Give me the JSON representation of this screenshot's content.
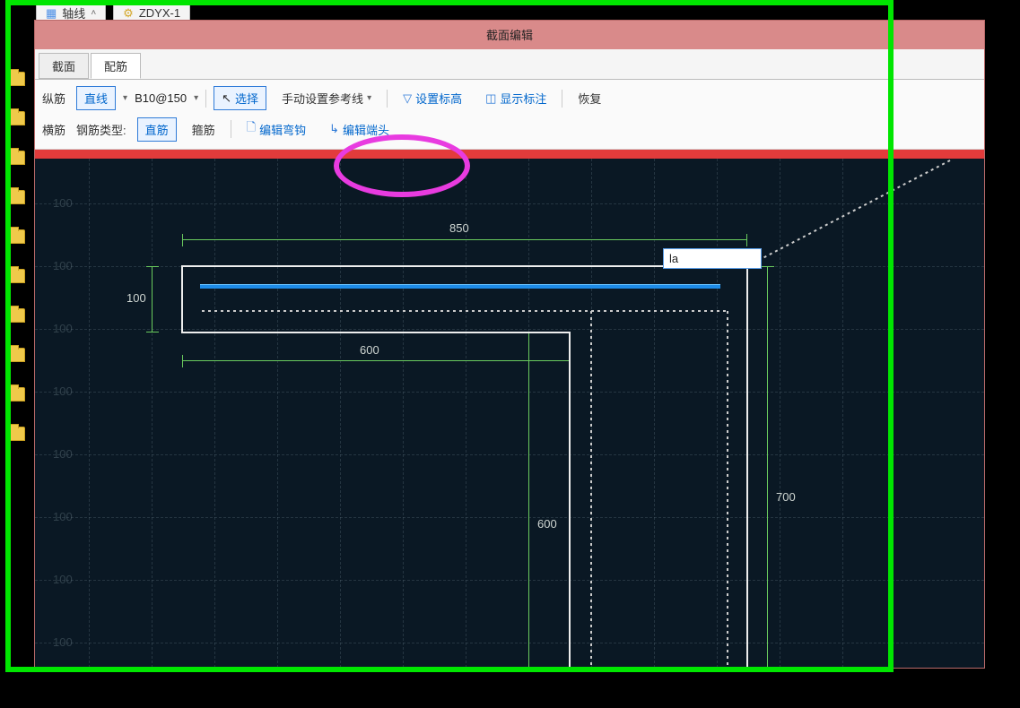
{
  "bg": {
    "tab1": "轴线",
    "tab2": "ZDYX-1"
  },
  "dialog": {
    "title": "截面编辑",
    "tabs": {
      "section": "截面",
      "rebar": "配筋"
    },
    "row1": {
      "label": "纵筋",
      "line_btn": "直线",
      "spec": "B10@150",
      "select": "选择",
      "refline": "手动设置参考线",
      "set_elev": "设置标高",
      "show_dim": "显示标注",
      "restore": "恢复"
    },
    "row2": {
      "label": "横筋",
      "type_label": "钢筋类型:",
      "straight": "直筋",
      "stirrup": "箍筋",
      "edit_hook": "编辑弯钩",
      "edit_end": "编辑端头"
    }
  },
  "canvas": {
    "grid_ruler": [
      "100",
      "100",
      "100",
      "100",
      "100",
      "100",
      "100",
      "100"
    ],
    "dim_850": "850",
    "dim_600h": "600",
    "dim_100v": "100",
    "dim_600v": "600",
    "dim_700v": "700",
    "input_value": "la"
  }
}
